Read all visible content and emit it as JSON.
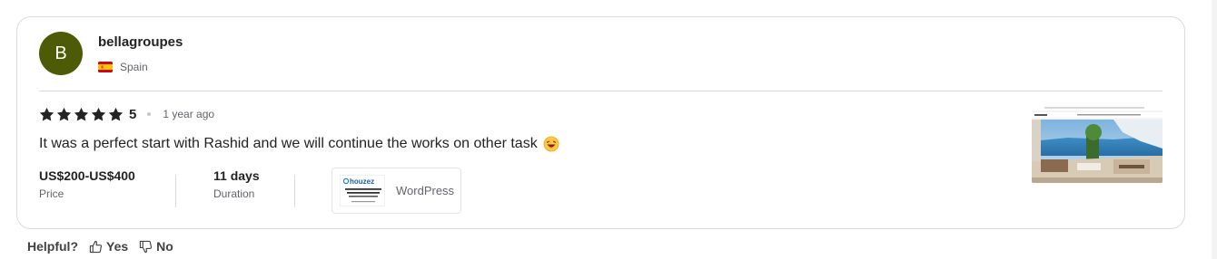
{
  "review": {
    "avatar_letter": "B",
    "username": "bellagroupes",
    "country": "Spain",
    "rating": "5",
    "time_ago": "1 year ago",
    "text": "It was a perfect start with Rashid and we will continue the works on other task",
    "price_value": "US$200-US$400",
    "price_label": "Price",
    "duration_value": "11 days",
    "duration_label": "Duration",
    "technology": "WordPress",
    "tech_thumb_brand": "houzez"
  },
  "helpful": {
    "label": "Helpful?",
    "yes": "Yes",
    "no": "No"
  },
  "colors": {
    "avatar_bg": "#4d5b07",
    "text_primary": "#222325",
    "text_secondary": "#62646a",
    "border": "#dadbdd"
  },
  "icons": [
    "flag-spain-icon",
    "star-icon",
    "laughing-emoji-icon",
    "thumbs-up-icon",
    "thumbs-down-icon"
  ]
}
